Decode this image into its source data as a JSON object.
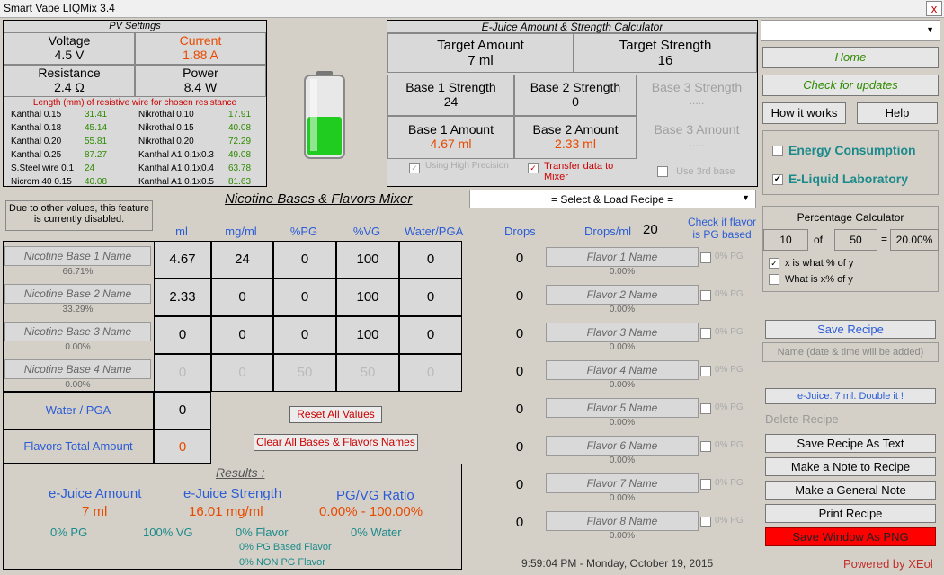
{
  "window": {
    "title": "Smart Vape LIQMix 3.4",
    "close": "x"
  },
  "pv": {
    "title": "PV Settings",
    "voltage_label": "Voltage",
    "voltage": "4.5 V",
    "current_label": "Current",
    "current": "1.88 A",
    "resistance_label": "Resistance",
    "resistance": "2.4 Ω",
    "power_label": "Power",
    "power": "8.4 W",
    "wire_title": "Length (mm) of resistive wire for chosen resistance",
    "wires": [
      [
        "Kanthal 0.15",
        "31.41",
        "Nikrothal 0.10",
        "17.91"
      ],
      [
        "Kanthal 0.18",
        "45.14",
        "Nikrothal 0.15",
        "40.08"
      ],
      [
        "Kanthal 0.20",
        "55.81",
        "Nikrothal 0.20",
        "72.29"
      ],
      [
        "Kanthal 0.25",
        "87.27",
        "Kanthal A1 0.1x0.3",
        "49.08"
      ],
      [
        "S.Steel wire 0.1",
        "24",
        "Kanthal A1 0.1x0.4",
        "63.78"
      ],
      [
        "Nicrom 40 0.15",
        "40.08",
        "Kanthal A1 0.1x0.5",
        "81.63"
      ]
    ]
  },
  "calc": {
    "title": "E-Juice Amount & Strength Calculator",
    "target_amount_label": "Target Amount",
    "target_amount": "7 ml",
    "target_strength_label": "Target Strength",
    "target_strength": "16",
    "b1s_label": "Base 1 Strength",
    "b1s": "24",
    "b2s_label": "Base 2 Strength",
    "b2s": "0",
    "b3s_label": "Base 3 Strength",
    "b3s": ".....",
    "b1a_label": "Base 1 Amount",
    "b1a": "4.67  ml",
    "b2a_label": "Base 2 Amount",
    "b2a": "2.33  ml",
    "b3a_label": "Base 3 Amount",
    "b3a": ".....",
    "opt1": "Using High Precision",
    "opt2": "Transfer data to Mixer",
    "opt3": "Use 3rd base"
  },
  "mixer": {
    "title": "Nicotine Bases & Flavors Mixer",
    "disabled_note": "Due to other values, this feature is currently disabled.",
    "recipe_select": "= Select & Load Recipe =",
    "headers": [
      "ml",
      "mg/ml",
      "%PG",
      "%VG",
      "Water/PGA"
    ],
    "drops_header": "Drops",
    "dropsml_label": "Drops/ml",
    "dropsml": "20",
    "pg_check_header": "Check if flavor is PG based",
    "bases": [
      {
        "name": "Nicotine Base 1 Name",
        "pct": "66.71%",
        "ml": "4.67",
        "mg": "24",
        "pg": "0",
        "vg": "100",
        "water": "0"
      },
      {
        "name": "Nicotine Base 2 Name",
        "pct": "33.29%",
        "ml": "2.33",
        "mg": "0",
        "pg": "0",
        "vg": "100",
        "water": "0"
      },
      {
        "name": "Nicotine Base 3 Name",
        "pct": "0.00%",
        "ml": "0",
        "mg": "0",
        "pg": "0",
        "vg": "100",
        "water": "0"
      },
      {
        "name": "Nicotine Base 4 Name",
        "pct": "0.00%",
        "ml": "0",
        "mg": "0",
        "pg": "50",
        "vg": "50",
        "water": "0"
      }
    ],
    "water_label": "Water / PGA",
    "water_val": "0",
    "flavors_label": "Flavors Total Amount",
    "flavors_val": "0",
    "reset_btn": "Reset All Values",
    "clear_btn": "Clear All Bases & Flavors Names",
    "flavors": [
      {
        "name": "Flavor 1 Name",
        "drops": "0",
        "pct": "0.00%",
        "pg": "0% PG"
      },
      {
        "name": "Flavor 2 Name",
        "drops": "0",
        "pct": "0.00%",
        "pg": "0% PG"
      },
      {
        "name": "Flavor 3 Name",
        "drops": "0",
        "pct": "0.00%",
        "pg": "0% PG"
      },
      {
        "name": "Flavor 4 Name",
        "drops": "0",
        "pct": "0.00%",
        "pg": "0% PG"
      },
      {
        "name": "Flavor 5 Name",
        "drops": "0",
        "pct": "0.00%",
        "pg": "0% PG"
      },
      {
        "name": "Flavor 6 Name",
        "drops": "0",
        "pct": "0.00%",
        "pg": "0% PG"
      },
      {
        "name": "Flavor 7 Name",
        "drops": "0",
        "pct": "0.00%",
        "pg": "0% PG"
      },
      {
        "name": "Flavor 8 Name",
        "drops": "0",
        "pct": "0.00%",
        "pg": "0% PG"
      }
    ]
  },
  "results": {
    "title": "Results :",
    "amount_label": "e-Juice Amount",
    "amount": "7 ml",
    "strength_label": "e-Juice Strength",
    "strength": "16.01 mg/ml",
    "ratio_label": "PG/VG Ratio",
    "ratio": "0.00% - 100.00%",
    "pg": "0% PG",
    "vg": "100% VG",
    "flavor": "0% Flavor",
    "water": "0% Water",
    "pg_flavor": "0% PG Based Flavor",
    "nonpg_flavor": "0% NON PG Flavor"
  },
  "clock": "9:59:04 PM  -  Monday, October 19, 2015",
  "side": {
    "home": "Home",
    "updates": "Check for updates",
    "how": "How it works",
    "help": "Help",
    "energy": "Energy Consumption",
    "lab": "E-Liquid Laboratory",
    "pc_title": "Percentage Calculator",
    "pc_a": "10",
    "pc_of": "of",
    "pc_b": "50",
    "pc_eq": "=",
    "pc_res": "20.00%",
    "pc_opt1": "x is what % of y",
    "pc_opt2": "What is x% of y",
    "save_recipe": "Save Recipe",
    "name_placeholder": "Name (date & time will be added)",
    "double": "e-Juice: 7 ml.  Double it !",
    "delete": "Delete Recipe",
    "save_text": "Save Recipe As Text",
    "note_recipe": "Make a Note to Recipe",
    "note_general": "Make a General Note",
    "print": "Print Recipe",
    "save_png": "Save Window As PNG",
    "powered": "Powered by XEol"
  }
}
